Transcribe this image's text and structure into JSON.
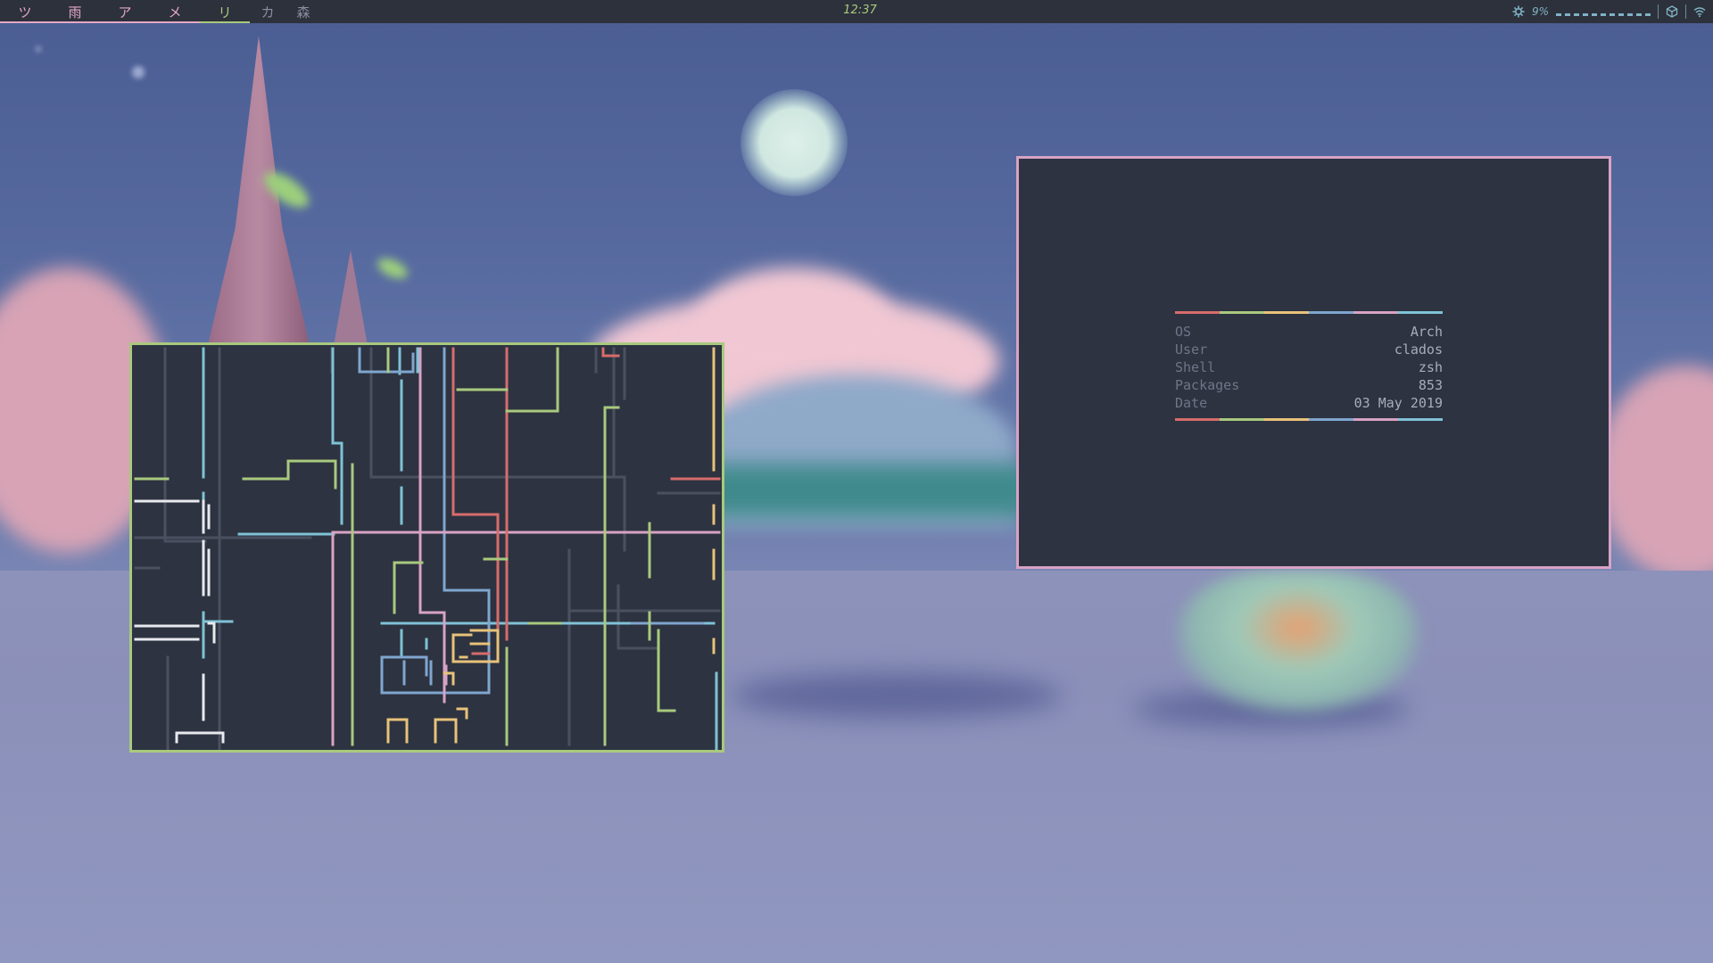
{
  "topbar": {
    "workspaces": [
      {
        "label": "ツ",
        "state": "active",
        "underline": "#e2a8c6"
      },
      {
        "label": "雨",
        "state": "active",
        "underline": "#e2a8c6"
      },
      {
        "label": "ア",
        "state": "active",
        "underline": "#e2a8c6"
      },
      {
        "label": "メ",
        "state": "active",
        "underline": "#e2a8c6"
      },
      {
        "label": "リ",
        "state": "focused",
        "underline": "#a9c97e"
      },
      {
        "label": "カ",
        "state": "inactive",
        "underline": ""
      },
      {
        "label": "森",
        "state": "inactive",
        "underline": ""
      }
    ],
    "clock": "12:37",
    "tray": {
      "cpu_icon": "gear-icon",
      "cpu_value": "9%",
      "package_icon": "package-icon",
      "network_icon": "wifi-icon"
    }
  },
  "colors": {
    "bar_bg": "#2d313b",
    "window_bg": "#2d3340",
    "pipes_border": "#a9c97e",
    "fetch_border": "#d7a3c5",
    "red": "#d76c6c",
    "green": "#a9c97e",
    "yellow": "#e8c27a",
    "blue": "#7fa6cf",
    "cyan": "#7fc2d6",
    "magenta": "#d7a3c5",
    "white": "#e7e9ee",
    "dim": "#4a5060"
  },
  "fetch": {
    "colorbar": [
      "#d76c6c",
      "#a9c97e",
      "#e8c27a",
      "#7fa6cf",
      "#d7a3c5",
      "#7fc2d6"
    ],
    "rows": [
      {
        "key": "OS",
        "value": "Arch"
      },
      {
        "key": "User",
        "value": "clados"
      },
      {
        "key": "Shell",
        "value": "zsh"
      },
      {
        "key": "Packages",
        "value": "853"
      },
      {
        "key": "Date",
        "value": "03 May 2019"
      }
    ]
  }
}
